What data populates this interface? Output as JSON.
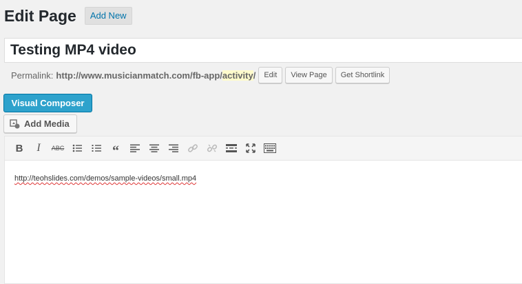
{
  "header": {
    "title": "Edit Page",
    "add_new_label": "Add New"
  },
  "post": {
    "title": "Testing MP4 video"
  },
  "permalink": {
    "label": "Permalink:",
    "url_base": "http://www.musicianmatch.com/fb-app/",
    "slug": "activity",
    "trailing": "/",
    "buttons": {
      "edit": "Edit",
      "view": "View Page",
      "shortlink": "Get Shortlink"
    }
  },
  "visual_composer_label": "Visual Composer",
  "add_media_label": "Add Media",
  "toolbar": {
    "icons": [
      "bold-icon",
      "italic-icon",
      "strikethrough-icon",
      "bullet-list-icon",
      "numbered-list-icon",
      "blockquote-icon",
      "align-left-icon",
      "align-center-icon",
      "align-right-icon",
      "link-icon",
      "unlink-icon",
      "read-more-icon",
      "fullscreen-icon",
      "toolbar-toggle-icon"
    ]
  },
  "editor": {
    "content": "http://teohslides.com/demos/sample-videos/small.mp4"
  },
  "colors": {
    "primary": "#2ea2cc",
    "link": "#0073aa",
    "highlight": "#fffbcc"
  }
}
